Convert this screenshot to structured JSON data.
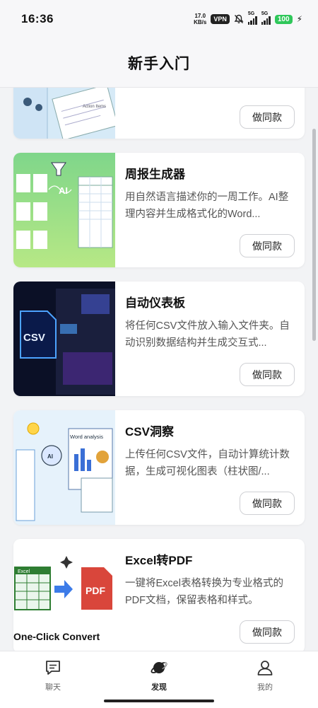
{
  "status": {
    "time": "16:36",
    "net_speed_value": "17.0",
    "net_speed_unit": "KB/s",
    "vpn": "VPN",
    "sig1_tag": "5G",
    "sig2_tag": "5G",
    "battery": "100"
  },
  "header": {
    "title": "新手入门"
  },
  "cards": [
    {
      "title": "",
      "desc": "",
      "button": "做同款",
      "image_text": "Action Items"
    },
    {
      "title": "周报生成器",
      "desc": "用自然语言描述你的一周工作。AI整理内容并生成格式化的Word...",
      "button": "做同款",
      "image_text": "AI"
    },
    {
      "title": "自动仪表板",
      "desc": "将任何CSV文件放入输入文件夹。自动识别数据结构并生成交互式...",
      "button": "做同款",
      "image_text": "CSV"
    },
    {
      "title": "CSV洞察",
      "desc": "上传任何CSV文件，自动计算统计数据，生成可视化图表（柱状图/...",
      "button": "做同款",
      "image_text": "Word analysis"
    },
    {
      "title": "Excel转PDF",
      "desc": "一键将Excel表格转换为专业格式的PDF文档，保留表格和样式。",
      "button": "做同款",
      "image_text": "One-Click Convert"
    }
  ],
  "nav": [
    {
      "label": "聊天",
      "icon": "chat-icon",
      "active": false
    },
    {
      "label": "发现",
      "icon": "discover-icon",
      "active": true
    },
    {
      "label": "我的",
      "icon": "profile-icon",
      "active": false
    }
  ],
  "colors": {
    "battery": "#2fc75a",
    "background": "#f2f3f5"
  }
}
